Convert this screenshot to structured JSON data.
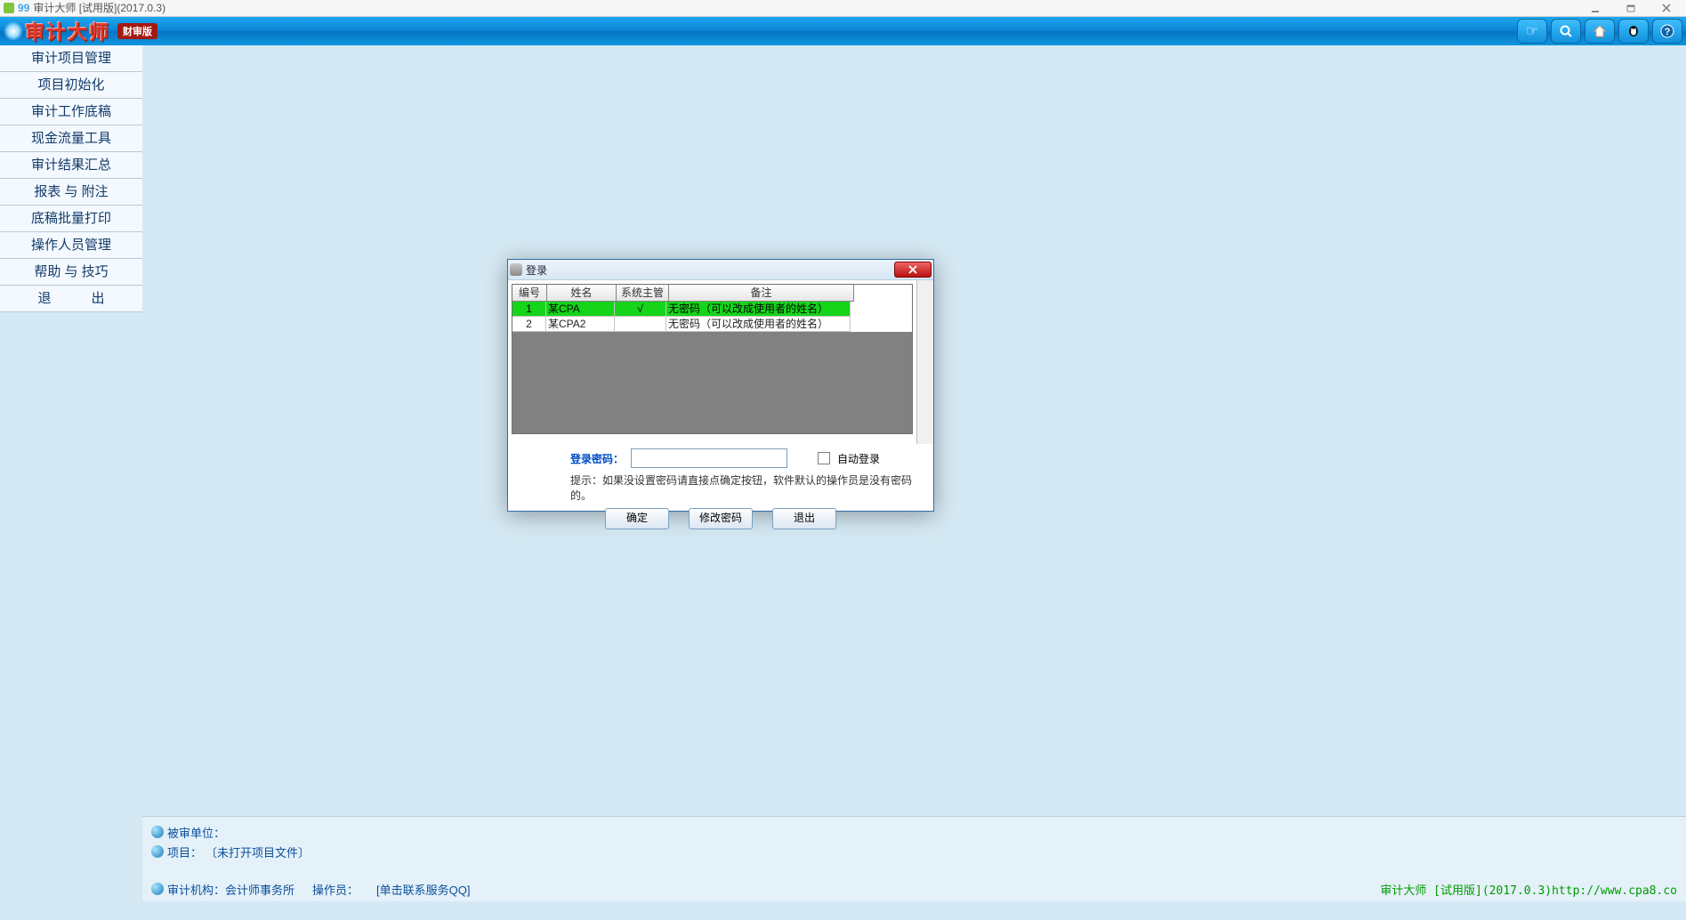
{
  "window": {
    "title_prefix": "99",
    "title": "审计大师 [试用版](2017.0.3)"
  },
  "banner": {
    "title": "审计大师",
    "badge": "财审版"
  },
  "header_buttons": {
    "hand": "hand-icon",
    "search": "search-icon",
    "home": "home-icon",
    "qq": "qq-icon",
    "help": "help-icon"
  },
  "sidebar": {
    "items": [
      "审计项目管理",
      "项目初始化",
      "审计工作底稿",
      "现金流量工具",
      "审计结果汇总",
      "报表 与 附注",
      "底稿批量打印",
      "操作人员管理",
      "帮助 与 技巧",
      "退　　　出"
    ]
  },
  "login": {
    "title": "登录",
    "columns": {
      "idx": "编号",
      "name": "姓名",
      "admin": "系统主管",
      "note": "备注"
    },
    "rows": [
      {
        "idx": "1",
        "name": "某CPA",
        "admin": "√",
        "note": "无密码（可以改成使用者的姓名）",
        "selected": true
      },
      {
        "idx": "2",
        "name": "某CPA2",
        "admin": "",
        "note": "无密码（可以改成使用者的姓名）",
        "selected": false
      }
    ],
    "pwd_label": "登录密码：",
    "auto_login_label": "自动登录",
    "hint": "提示：如果没设置密码请直接点确定按钮，软件默认的操作员是没有密码的。",
    "buttons": {
      "ok": "确定",
      "change": "修改密码",
      "exit": "退出"
    }
  },
  "footer": {
    "line1_label": "被审单位：",
    "line2_prefix": "项目：",
    "line2_value": "〔未打开项目文件〕",
    "bottom_left_org_label": "审计机构：",
    "bottom_left_org": "会计师事务所",
    "bottom_left_op_label": "操作员：",
    "bottom_left_qq": "[单击联系服务QQ]",
    "bottom_right": "审计大师 [试用版](2017.0.3)http://www.cpa8.co"
  }
}
